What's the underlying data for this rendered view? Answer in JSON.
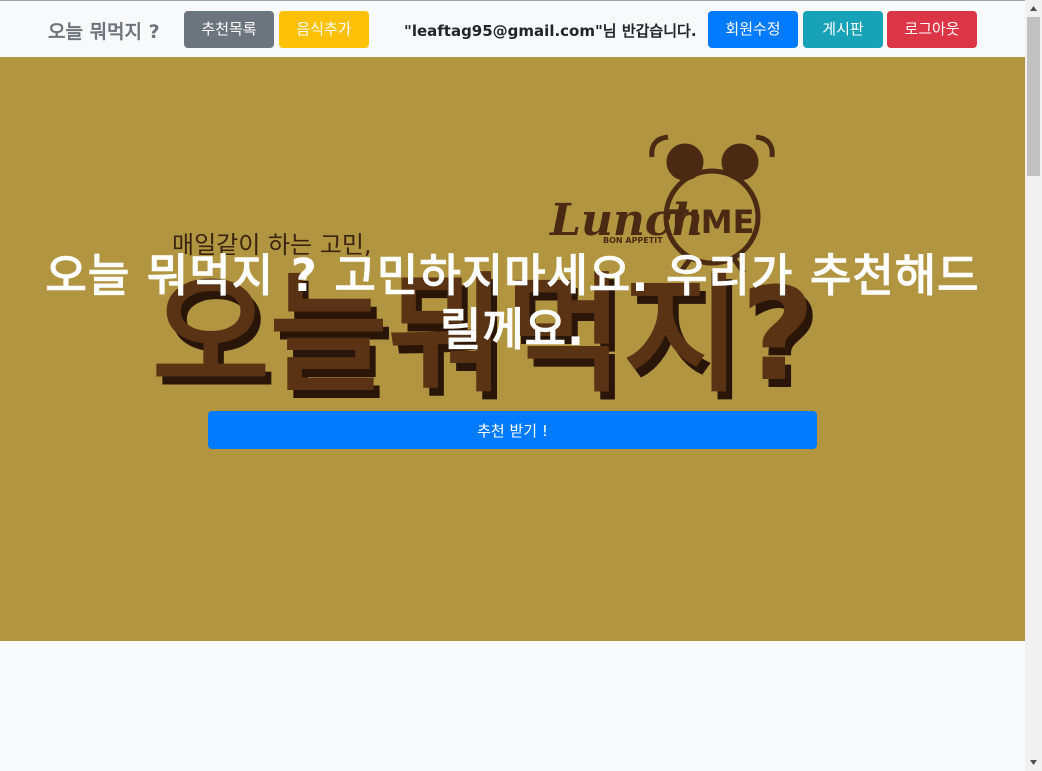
{
  "navbar": {
    "brand": "오늘 뭐먹지 ?",
    "recommend_list_label": "추천목록",
    "add_food_label": "음식추가",
    "greeting": "\"leaftag95@gmail.com\"님 반갑습니다.",
    "edit_member_label": "회원수정",
    "board_label": "게시판",
    "logout_label": "로그아웃"
  },
  "hero": {
    "banner_subtitle": "매일같이 하는 고민,",
    "banner_logo_lunch": "Lunch",
    "banner_logo_time": "TIME",
    "banner_logo_tag": "BON APPETIT",
    "banner_big_text": "오늘뭐먹지?",
    "headline": "오늘 뭐먹지 ? 고민하지마세요. 우리가 추천해드릴께요.",
    "cta_label": "추천 받기 !"
  },
  "colors": {
    "hero_bg": "#b29540",
    "primary": "#007bff",
    "secondary": "#6c757d",
    "warning": "#ffc107",
    "info": "#17a2b8",
    "danger": "#dc3545",
    "banner_brown": "#5a3214"
  },
  "icons": {
    "alarm_clock": "alarm-clock-icon",
    "scroll_up": "scroll-up-arrow-icon",
    "scroll_down": "scroll-down-arrow-icon"
  }
}
